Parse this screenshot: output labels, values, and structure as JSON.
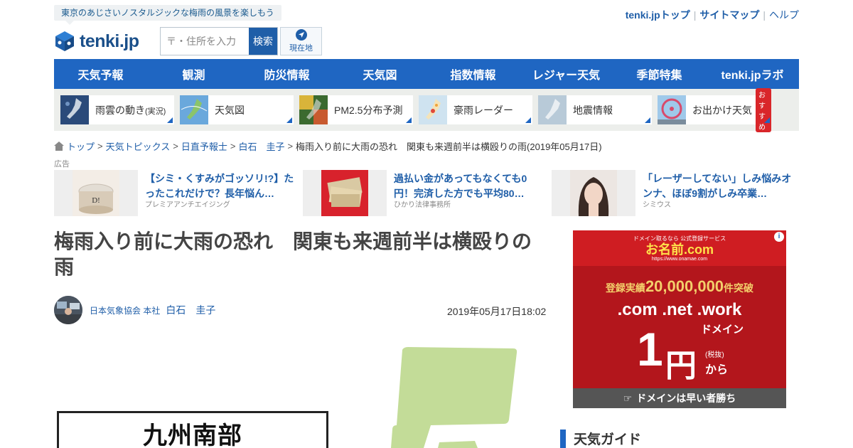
{
  "header": {
    "tagline": "東京のあじさいノスタルジックな梅雨の風景を楽しもう",
    "logo_text": "tenki.jp",
    "search_placeholder": "〒・住所を入力",
    "search_button": "検索",
    "locate_label": "現在地",
    "top_links": [
      "tenki.jpトップ",
      "サイトマップ",
      "ヘルプ"
    ]
  },
  "nav": [
    "天気予報",
    "観測",
    "防災情報",
    "天気図",
    "指数情報",
    "レジャー天気",
    "季節特集",
    "tenki.jpラボ"
  ],
  "quick_links": [
    {
      "label": "雨雲の動き",
      "note": "(実況)"
    },
    {
      "label": "天気図",
      "note": ""
    },
    {
      "label": "PM2.5分布予測",
      "note": ""
    },
    {
      "label": "豪雨レーダー",
      "note": ""
    },
    {
      "label": "地震情報",
      "note": ""
    },
    {
      "label": "お出かけ天気",
      "note": "",
      "badge": "おすすめ"
    }
  ],
  "breadcrumb": {
    "items": [
      "トップ",
      "天気トピックス",
      "日直予報士",
      "白石　圭子"
    ],
    "current": "梅雨入り前に大雨の恐れ　関東も来週前半は横殴りの雨(2019年05月17日)"
  },
  "ads": {
    "label": "広告",
    "items": [
      {
        "title": "【シミ・くすみがゴッソリ!?】たったこれだけで？長年悩ん…",
        "source": "プレミアアンチエイジング"
      },
      {
        "title": "過払い金があってもなくても0円！完済した方でも平均80…",
        "source": "ひかり法律事務所"
      },
      {
        "title": "「レーザーしてない」しみ悩みオンナ、ほぼ9割がしみ卒業…",
        "source": "シミウス"
      }
    ]
  },
  "article": {
    "title": "梅雨入り前に大雨の恐れ　関東も来週前半は横殴りの雨",
    "author_org": "日本気象協会 本社",
    "author_name": "白石　圭子",
    "date": "2019年05月17日18:02",
    "map_region": "九州南部"
  },
  "side_ad": {
    "small": "ドメイン取るなら 公式登録サービス",
    "brand": "お名前.com",
    "url": "https://www.onamae.com",
    "rank_prefix": "登録実績",
    "rank_number": "20,000,000",
    "rank_suffix": "件突破",
    "tlds": ".com .net .work",
    "domain_word": "ドメイン",
    "price_num": "1",
    "price_unit": "円",
    "tax": "(税抜)",
    "kara": "から",
    "slogan": "ドメインは早い者勝ち"
  },
  "sidebar": {
    "guide_title": "天気ガイド"
  },
  "colors": {
    "brand_blue": "#1f66c2",
    "link_blue": "#1f5ea8",
    "ad_red": "#b3161c"
  }
}
